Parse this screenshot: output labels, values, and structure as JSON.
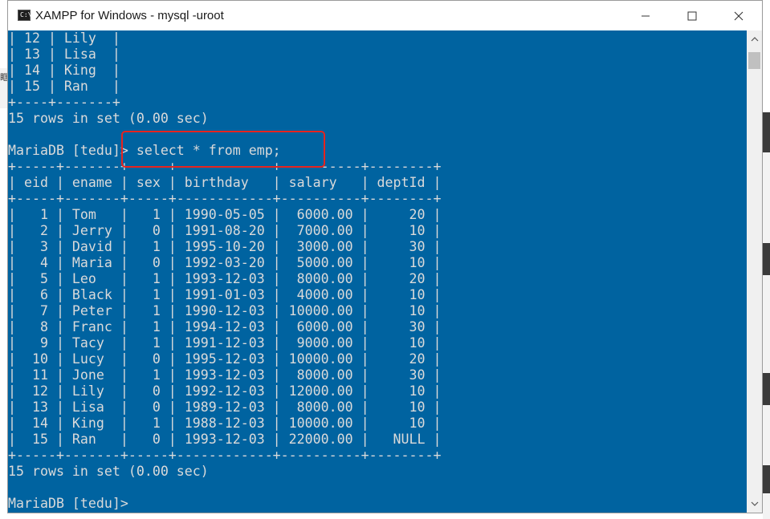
{
  "window": {
    "title": "XAMPP for Windows - mysql  -uroot",
    "icon_label": "C:\\."
  },
  "console": {
    "lines": [
      "| 12 | Lily  |",
      "| 13 | Lisa  |",
      "| 14 | King  |",
      "| 15 | Ran   |",
      "+----+-------+",
      "15 rows in set (0.00 sec)",
      "",
      "MariaDB [tedu]> select * from emp;",
      "+-----+-------+-----+------------+----------+--------+",
      "| eid | ename | sex | birthday   | salary   | deptId |",
      "+-----+-------+-----+------------+----------+--------+",
      "|   1 | Tom   |   1 | 1990-05-05 |  6000.00 |     20 |",
      "|   2 | Jerry |   0 | 1991-08-20 |  7000.00 |     10 |",
      "|   3 | David |   1 | 1995-10-20 |  3000.00 |     30 |",
      "|   4 | Maria |   0 | 1992-03-20 |  5000.00 |     10 |",
      "|   5 | Leo   |   1 | 1993-12-03 |  8000.00 |     20 |",
      "|   6 | Black |   1 | 1991-01-03 |  4000.00 |     10 |",
      "|   7 | Peter |   1 | 1990-12-03 | 10000.00 |     10 |",
      "|   8 | Franc |   1 | 1994-12-03 |  6000.00 |     30 |",
      "|   9 | Tacy  |   1 | 1991-12-03 |  9000.00 |     10 |",
      "|  10 | Lucy  |   0 | 1995-12-03 | 10000.00 |     20 |",
      "|  11 | Jone  |   1 | 1993-12-03 |  8000.00 |     30 |",
      "|  12 | Lily  |   0 | 1992-12-03 | 12000.00 |     10 |",
      "|  13 | Lisa  |   0 | 1989-12-03 |  8000.00 |     10 |",
      "|  14 | King  |   1 | 1988-12-03 | 10000.00 |     10 |",
      "|  15 | Ran   |   0 | 1993-12-03 | 22000.00 |   NULL |",
      "+-----+-------+-----+------------+----------+--------+",
      "15 rows in set (0.00 sec)",
      "",
      "MariaDB [tedu]>"
    ]
  },
  "colors": {
    "console_bg": "#0063a0",
    "console_fg": "#dadada",
    "highlight": "#e8231e"
  }
}
